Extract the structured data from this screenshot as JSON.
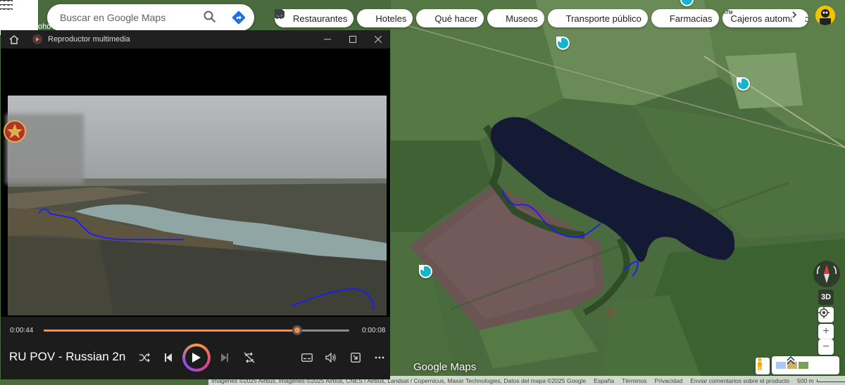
{
  "maps": {
    "search_placeholder": "Buscar en Google Maps",
    "behind_text": "oho",
    "chips": [
      {
        "label": "Restaurantes",
        "icon": "fork-knife-icon"
      },
      {
        "label": "Hoteles",
        "icon": "bed-icon"
      },
      {
        "label": "Qué hacer",
        "icon": "camera-icon"
      },
      {
        "label": "Museos",
        "icon": "museum-icon"
      },
      {
        "label": "Transporte público",
        "icon": "bus-icon"
      },
      {
        "label": "Farmacias",
        "icon": "pharmacy-icon"
      },
      {
        "label": "Cajeros automáticos",
        "icon": "atm-icon"
      }
    ],
    "btn_3d": "3D",
    "zoom_in": "+",
    "zoom_out": "−",
    "logo": "Google Maps",
    "footer": {
      "attribution": "Imágenes ©2025 Airbus, Imágenes ©2025 Airbus, CNES / Airbus, Landsat / Copernicus, Maxar Technologies, Datos del mapa ©2025 Google",
      "country": "España",
      "terms": "Términos",
      "privacy": "Privacidad",
      "feedback": "Enviar comentarios sobre el producto",
      "scale": "500 m"
    },
    "colors": {
      "poi": "#12b5cb",
      "annotation": "#1a1aff"
    }
  },
  "player": {
    "app_title": "Reproductor multimedia",
    "time_elapsed": "0:00:44",
    "time_remaining": "0:00:08",
    "progress": 0.83,
    "media_title": "RU POV - Russian 2n...",
    "accent": "#ff8a3c"
  }
}
